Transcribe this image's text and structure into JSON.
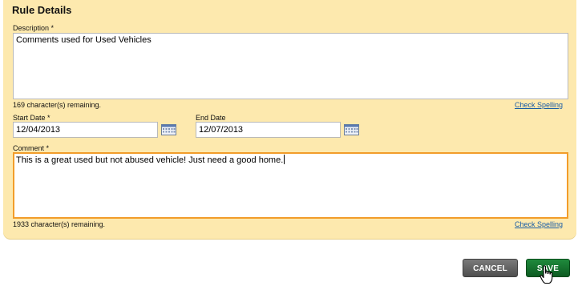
{
  "panel": {
    "title": "Rule Details"
  },
  "description": {
    "label": "Description *",
    "value": "Comments used for Used Vehicles",
    "remaining": "169 character(s) remaining.",
    "spell_link": "Check Spelling"
  },
  "start_date": {
    "label": "Start Date *",
    "value": "12/04/2013"
  },
  "end_date": {
    "label": "End Date",
    "value": "12/07/2013"
  },
  "comment": {
    "label": "Comment *",
    "value": "This is a great used but not abused vehicle! Just need a good home.",
    "remaining": "1933 character(s) remaining.",
    "spell_link": "Check Spelling"
  },
  "buttons": {
    "cancel": "CANCEL",
    "save": "SAVE"
  },
  "colors": {
    "panel_bg": "#fde9ae",
    "focus_border": "#f29d2a",
    "link": "#1a5da6",
    "save_bg": "#0d5b22",
    "cancel_bg": "#4f4f4f"
  }
}
